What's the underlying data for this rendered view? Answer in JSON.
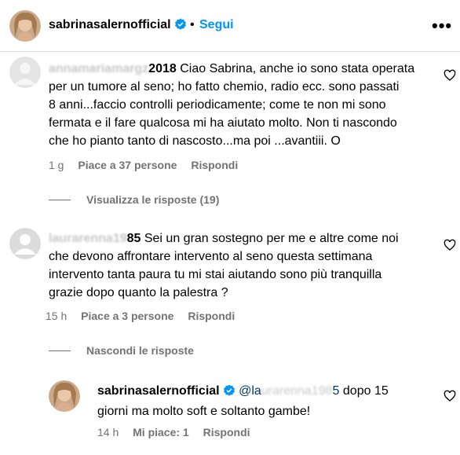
{
  "header": {
    "username": "sabrinasalernofficial",
    "separator": "•",
    "follow_label": "Segui",
    "more_label": "•••"
  },
  "comments": [
    {
      "username": "annamariamargz2018",
      "username_visible": "2018",
      "text": "Ciao Sabrina, anche io sono stata operata per un tumore al seno; ho fatto chemio, radio ecc. sono passati 8 anni...faccio controlli periodicamente; come te non mi sono fermata e il fare qualcosa mi ha aiutato molto. Non ti nascondo che ho pianto tanto di nascosto...ma poi ...avantiii. O",
      "line1": "Ciao Sabrina, anche io sono stata operata",
      "line2": "per un tumore al seno; ho fatto chemio, radio ecc. sono passati",
      "line3": "8 anni...faccio controlli periodicamente; come te non mi sono",
      "line4": "fermata e il fare qualcosa mi ha aiutato molto. Non ti nascondo",
      "line5": "che ho pianto tanto di nascosto...ma poi ...avantiii. O",
      "time": "1 g",
      "likes": "Piace a 37 persone",
      "reply_label": "Rispondi",
      "replies_toggle": "Visualizza le risposte (19)"
    },
    {
      "username": "laurarenna1985",
      "username_visible": "85",
      "line1": "Sei un gran sostegno per me e altre come noi",
      "line2": "che devono affrontare intervento al seno questa settimana",
      "line3": "intervento tanta paura tu mi stai aiutando sono più tranquilla",
      "line4": "grazie dopo quanto la palestra ?",
      "time": "15 h",
      "likes": "Piace a 3 persone",
      "reply_label": "Rispondi",
      "replies_toggle": "Nascondi le risposte"
    }
  ],
  "reply": {
    "username": "sabrinasalernofficial",
    "mention_visible": "5",
    "mention_prefix": "@la",
    "line1_rest": "dopo 15",
    "line2": "giorni ma molto soft e soltanto gambe!",
    "time": "14 h",
    "likes": "Mi piace: 1",
    "reply_label": "Rispondi"
  },
  "icons": {
    "verified": "verified-badge-icon",
    "heart": "heart-outline-icon",
    "default_avatar": "default-avatar-icon"
  },
  "colors": {
    "link_blue": "#0095f6",
    "verified_blue": "#0095f6",
    "muted": "#737373",
    "divider": "#dbdbdb"
  }
}
